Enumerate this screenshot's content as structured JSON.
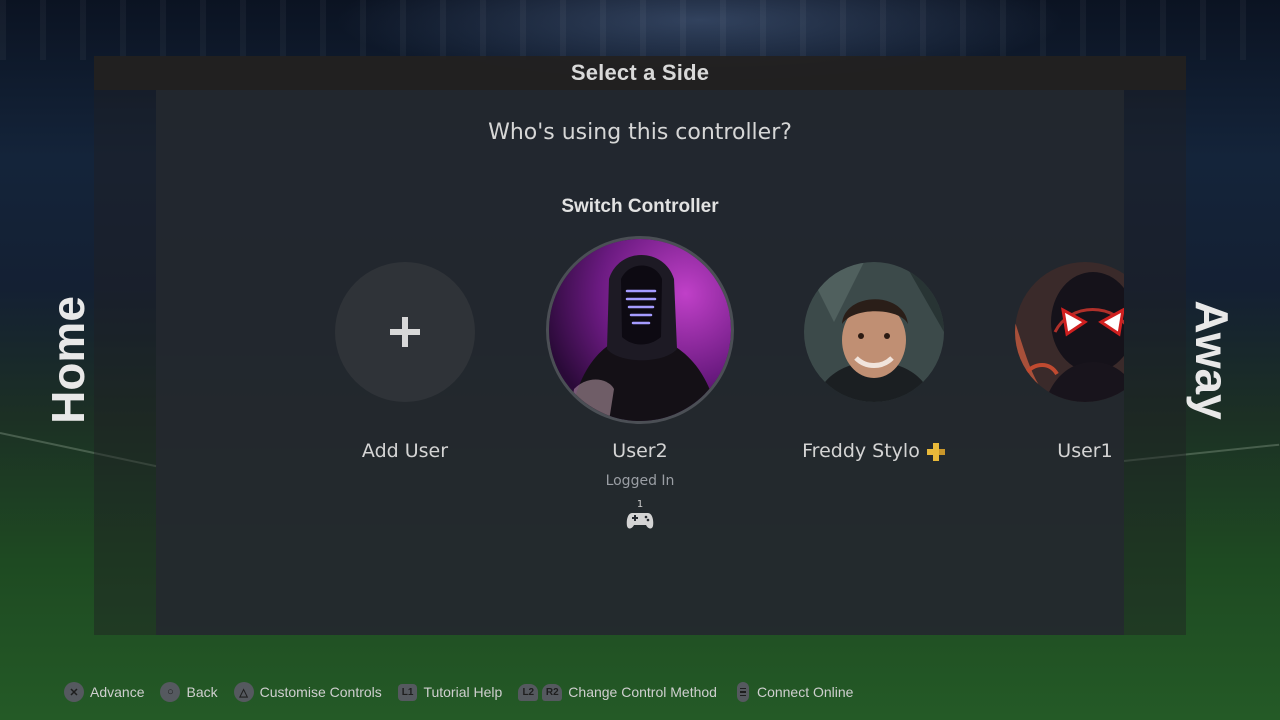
{
  "header": {
    "title": "Select a Side"
  },
  "sides": {
    "home": "Home",
    "away": "Away"
  },
  "panel": {
    "prompt": "Who's using this controller?",
    "switch_label": "Switch Controller"
  },
  "users": [
    {
      "name": "Add User",
      "icon": "plus-icon"
    },
    {
      "name": "User2",
      "status": "Logged In",
      "controller_number": "1",
      "icon": "gamepad-icon"
    },
    {
      "name": "Freddy Stylo",
      "badge": "playstation-plus-icon"
    },
    {
      "name": "User1"
    }
  ],
  "footer": {
    "hints": [
      {
        "button": "✕",
        "label": "Advance"
      },
      {
        "button": "○",
        "label": "Back"
      },
      {
        "button": "△",
        "label": "Customise Controls"
      },
      {
        "button": "L1",
        "label": "Tutorial Help"
      },
      {
        "button": "L2",
        "button2": "R2",
        "label": "Change Control Method"
      },
      {
        "button": "touchpad",
        "label": "Connect Online"
      }
    ]
  },
  "colors": {
    "panel": "#24282e",
    "title_bar": "#232120",
    "plus_gold": "#e8b93a",
    "pitch_green": "#245a26"
  }
}
